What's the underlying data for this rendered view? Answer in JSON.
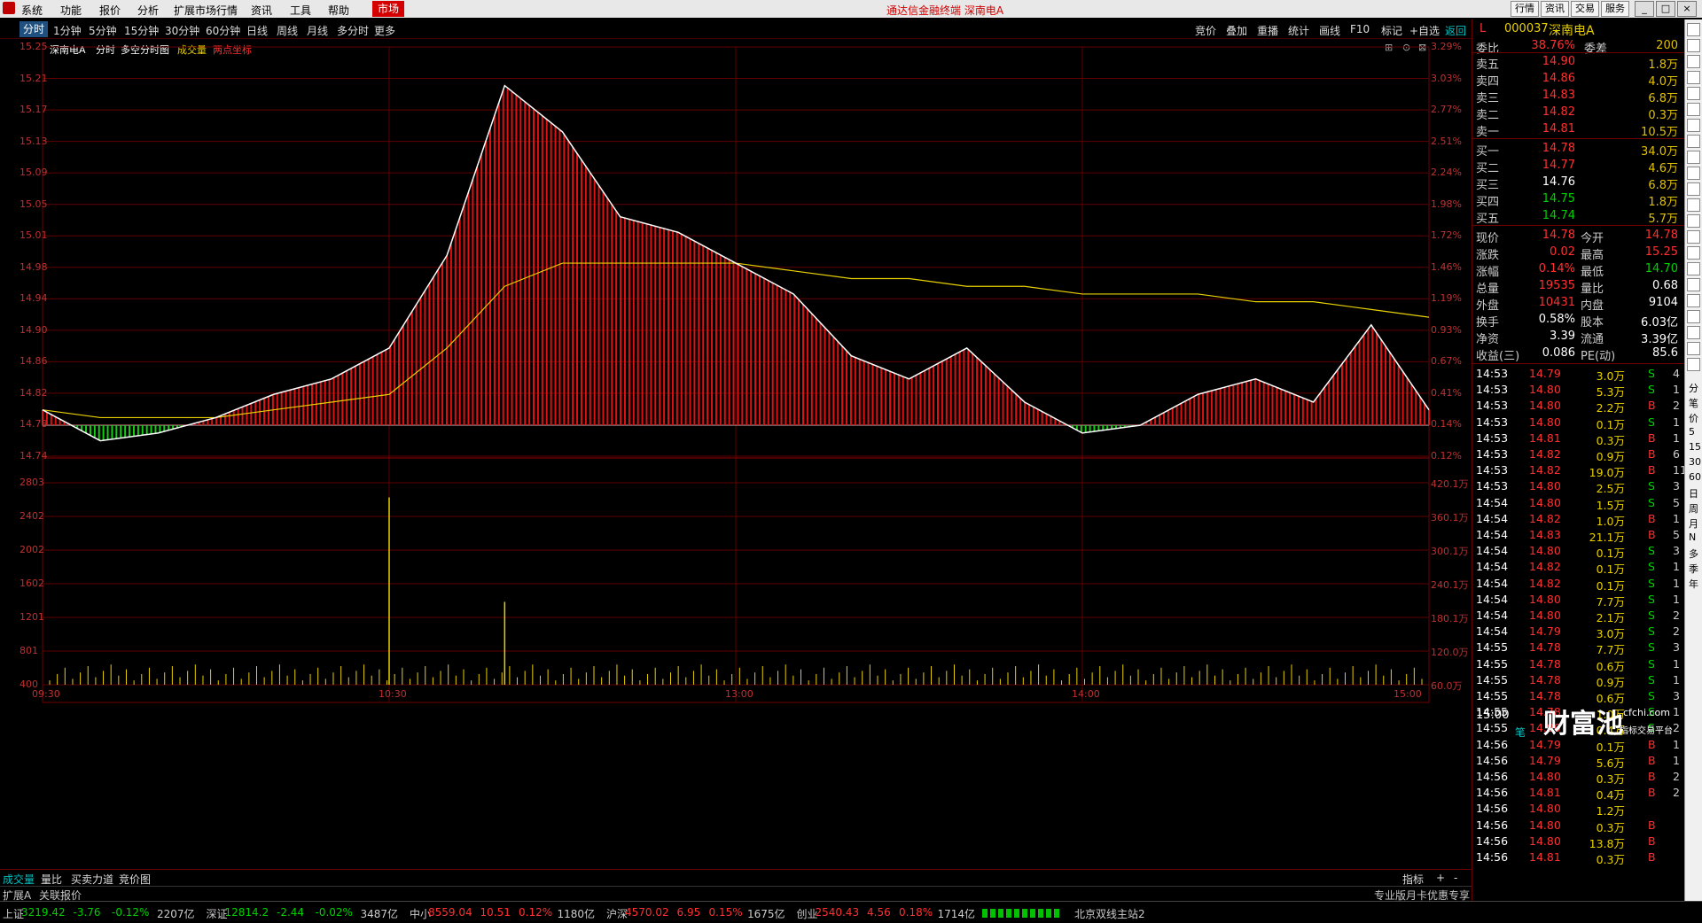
{
  "menu": {
    "items": [
      "系统",
      "功能",
      "报价",
      "分析",
      "扩展市场行情",
      "资讯",
      "工具",
      "帮助"
    ],
    "market": "市场",
    "title": "通达信金融终端  深南电A",
    "top_buttons": [
      "行情",
      "资讯",
      "交易",
      "服务"
    ]
  },
  "periods": {
    "items": [
      "分时",
      "1分钟",
      "5分钟",
      "15分钟",
      "30分钟",
      "60分钟",
      "日线",
      "周线",
      "月线",
      "多分时",
      "更多"
    ],
    "tools": [
      "竞价",
      "叠加",
      "重播",
      "统计",
      "画线",
      "F10",
      "标记",
      "+自选",
      "返回"
    ]
  },
  "chart_header": {
    "stock": "深南电A",
    "mode": "分时",
    "sub": "多空分时图",
    "volume_label": "成交量",
    "coord_label": "两点坐标"
  },
  "price_axis": {
    "left": [
      "15.25",
      "15.21",
      "15.17",
      "15.13",
      "15.09",
      "15.05",
      "15.01",
      "14.98",
      "14.94",
      "14.90",
      "14.86",
      "14.82",
      "14.78",
      "14.74"
    ],
    "right": [
      "3.29%",
      "3.03%",
      "2.77%",
      "2.51%",
      "2.24%",
      "1.98%",
      "1.72%",
      "1.46%",
      "1.19%",
      "0.93%",
      "0.67%",
      "0.41%",
      "0.14%",
      "0.12%"
    ]
  },
  "vol_axis": {
    "left": [
      "2803",
      "2402",
      "2002",
      "1602",
      "1201",
      "801",
      "400"
    ],
    "right": [
      "420.1万",
      "360.1万",
      "300.1万",
      "240.1万",
      "180.1万",
      "120.0万",
      "60.0万"
    ]
  },
  "time_axis": [
    "09:30",
    "10:30",
    "13:00",
    "14:00",
    "15:00"
  ],
  "bottom_tabs": {
    "items": [
      "成交量",
      "量比",
      "买卖力道",
      "竞价图"
    ],
    "right": [
      "指标",
      "+",
      "-"
    ]
  },
  "chart_data": {
    "type": "line",
    "title": "深南电A 分时",
    "xlabel": "",
    "ylabel": "",
    "prev_close": 14.76,
    "ylim": [
      14.72,
      15.25
    ],
    "x": [
      "09:30",
      "09:40",
      "09:50",
      "10:00",
      "10:10",
      "10:20",
      "10:30",
      "10:40",
      "10:50",
      "11:00",
      "11:10",
      "11:20",
      "11:30",
      "13:10",
      "13:20",
      "13:30",
      "13:40",
      "13:50",
      "14:00",
      "14:10",
      "14:20",
      "14:30",
      "14:40",
      "14:50",
      "15:00"
    ],
    "series": [
      {
        "values": [
          14.78,
          14.74,
          14.75,
          14.77,
          14.8,
          14.82,
          14.86,
          14.98,
          15.2,
          15.14,
          15.03,
          15.01,
          14.97,
          14.93,
          14.85,
          14.82,
          14.86,
          14.79,
          14.75,
          14.76,
          14.8,
          14.82,
          14.79,
          14.89,
          14.78
        ]
      },
      {
        "values": [
          14.78,
          14.77,
          14.77,
          14.77,
          14.78,
          14.79,
          14.8,
          14.86,
          14.94,
          14.97,
          14.97,
          14.97,
          14.97,
          14.96,
          14.95,
          14.95,
          14.94,
          14.94,
          14.93,
          14.93,
          14.93,
          14.92,
          14.92,
          14.91,
          14.9
        ]
      }
    ],
    "volume_ylim": [
      0,
      2803
    ],
    "volume_spikes": [
      {
        "x": "10:30",
        "v": 2600
      },
      {
        "x": "10:50",
        "v": 1150
      }
    ]
  },
  "quote": {
    "code": "000037",
    "name": "深南电A",
    "flag": "L",
    "weibi": {
      "l": "委比",
      "v": "38.76%",
      "l2": "委差",
      "v2": "200"
    },
    "asks": [
      {
        "l": "卖五",
        "p": "14.90",
        "v": "1.8万"
      },
      {
        "l": "卖四",
        "p": "14.86",
        "v": "4.0万"
      },
      {
        "l": "卖三",
        "p": "14.83",
        "v": "6.8万"
      },
      {
        "l": "卖二",
        "p": "14.82",
        "v": "0.3万"
      },
      {
        "l": "卖一",
        "p": "14.81",
        "v": "10.5万"
      }
    ],
    "bids": [
      {
        "l": "买一",
        "p": "14.78",
        "v": "34.0万"
      },
      {
        "l": "买二",
        "p": "14.77",
        "v": "4.6万"
      },
      {
        "l": "买三",
        "p": "14.76",
        "v": "6.8万"
      },
      {
        "l": "买四",
        "p": "14.75",
        "v": "1.8万"
      },
      {
        "l": "买五",
        "p": "14.74",
        "v": "5.7万"
      }
    ],
    "stats": [
      {
        "l": "现价",
        "v": "14.78",
        "l2": "今开",
        "v2": "14.78"
      },
      {
        "l": "涨跌",
        "v": "0.02",
        "l2": "最高",
        "v2": "15.25"
      },
      {
        "l": "涨幅",
        "v": "0.14%",
        "l2": "最低",
        "v2": "14.70"
      },
      {
        "l": "总量",
        "v": "19535",
        "l2": "量比",
        "v2": "0.68"
      },
      {
        "l": "外盘",
        "v": "10431",
        "l2": "内盘",
        "v2": "9104"
      },
      {
        "l": "换手",
        "v": "0.58%",
        "l2": "股本",
        "v2": "6.03亿"
      },
      {
        "l": "净资",
        "v": "3.39",
        "l2": "流通",
        "v2": "3.39亿"
      },
      {
        "l": "收益(三)",
        "v": "0.086",
        "l2": "PE(动)",
        "v2": "85.6"
      }
    ]
  },
  "trades": [
    [
      "14:53",
      "14.79",
      "3.0万",
      "S",
      "4"
    ],
    [
      "14:53",
      "14.80",
      "5.3万",
      "S",
      "1"
    ],
    [
      "14:53",
      "14.80",
      "2.2万",
      "B",
      "2"
    ],
    [
      "14:53",
      "14.80",
      "0.1万",
      "S",
      "1"
    ],
    [
      "14:53",
      "14.81",
      "0.3万",
      "B",
      "1"
    ],
    [
      "14:53",
      "14.82",
      "0.9万",
      "B",
      "6"
    ],
    [
      "14:53",
      "14.82",
      "19.0万",
      "B",
      "11"
    ],
    [
      "14:53",
      "14.80",
      "2.5万",
      "S",
      "3"
    ],
    [
      "14:54",
      "14.80",
      "1.5万",
      "S",
      "5"
    ],
    [
      "14:54",
      "14.82",
      "1.0万",
      "B",
      "1"
    ],
    [
      "14:54",
      "14.83",
      "21.1万",
      "B",
      "5"
    ],
    [
      "14:54",
      "14.80",
      "0.1万",
      "S",
      "3"
    ],
    [
      "14:54",
      "14.82",
      "0.1万",
      "S",
      "1"
    ],
    [
      "14:54",
      "14.82",
      "0.1万",
      "S",
      "1"
    ],
    [
      "14:54",
      "14.80",
      "7.7万",
      "S",
      "1"
    ],
    [
      "14:54",
      "14.80",
      "2.1万",
      "S",
      "2"
    ],
    [
      "14:54",
      "14.79",
      "3.0万",
      "S",
      "2"
    ],
    [
      "14:55",
      "14.78",
      "7.7万",
      "S",
      "3"
    ],
    [
      "14:55",
      "14.78",
      "0.6万",
      "S",
      "1"
    ],
    [
      "14:55",
      "14.78",
      "0.9万",
      "S",
      "1"
    ],
    [
      "14:55",
      "14.78",
      "0.6万",
      "S",
      "3"
    ],
    [
      "14:55",
      "14.78",
      "1.0万",
      "S",
      "1"
    ],
    [
      "14:55",
      "14.80",
      "0.4万",
      "S",
      "2"
    ],
    [
      "14:56",
      "14.79",
      "0.1万",
      "B",
      "1"
    ],
    [
      "14:56",
      "14.79",
      "5.6万",
      "B",
      "1"
    ],
    [
      "14:56",
      "14.80",
      "0.3万",
      "B",
      "2"
    ],
    [
      "14:56",
      "14.81",
      "0.4万",
      "B",
      "2"
    ],
    [
      "14:56",
      "14.80",
      "1.2万",
      "",
      ""
    ],
    [
      "14:56",
      "14.80",
      "0.3万",
      "B",
      ""
    ],
    [
      "14:56",
      "14.80",
      "13.8万",
      "B",
      ""
    ],
    [
      "14:56",
      "14.81",
      "0.3万",
      "B",
      ""
    ]
  ],
  "trade_footer": {
    "time": "15:00",
    "sub": "笔",
    "watermark": "财富池",
    "url": "cfchi.com",
    "tag": "指标交易平台"
  },
  "side_chars": [
    "分",
    "笔",
    "价",
    "5",
    "15",
    "30",
    "60",
    "日",
    "周",
    "月",
    "N",
    "多",
    "季",
    "年"
  ],
  "index_bar": [
    {
      "n": "上证",
      "p": "3219.42",
      "c": "-3.76",
      "r": "-0.12%",
      "a": "2207亿",
      "color": "#00d000"
    },
    {
      "n": "深证",
      "p": "12814.2",
      "c": "-2.44",
      "r": "-0.02%",
      "a": "3487亿",
      "color": "#00d000"
    },
    {
      "n": "中小",
      "p": "8559.04",
      "c": "10.51",
      "r": "0.12%",
      "a": "1180亿",
      "color": "#ff3030"
    },
    {
      "n": "沪深",
      "p": "4570.02",
      "c": "6.95",
      "r": "0.15%",
      "a": "1675亿",
      "color": "#ff3030"
    },
    {
      "n": "创业",
      "p": "2540.43",
      "c": "4.56",
      "r": "0.18%",
      "a": "1714亿",
      "color": "#ff3030"
    }
  ],
  "index_extra": {
    "ext": "扩展A",
    "related": "关联报价",
    "server": "北京双线主站2",
    "promo": "专业版月卡优惠专享"
  }
}
